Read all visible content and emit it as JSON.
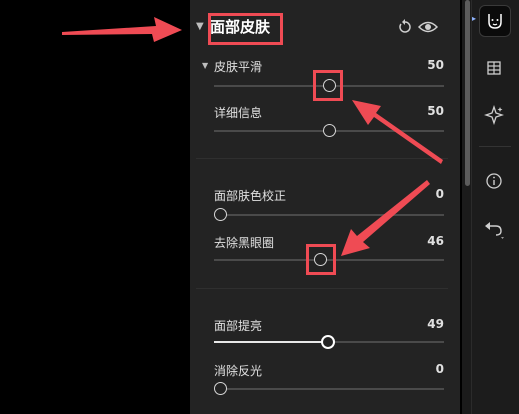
{
  "section": {
    "title": "面部皮肤",
    "caret": "▼",
    "reset_icon": "reset-icon",
    "visibility_icon": "eye-icon"
  },
  "sliders": [
    {
      "label": "皮肤平滑",
      "value": "50",
      "position": 0.5,
      "expanded_caret": "▼"
    },
    {
      "label": "详细信息",
      "value": "50",
      "position": 0.5
    },
    {
      "label": "面部肤色校正",
      "value": "0",
      "position": 0.0
    },
    {
      "label": "去除黑眼圈",
      "value": "46",
      "position": 0.46
    },
    {
      "label": "面部提亮",
      "value": "49",
      "position": 0.49,
      "active": true
    },
    {
      "label": "消除反光",
      "value": "0",
      "position": 0.0
    }
  ],
  "toolbar": {
    "items": [
      "face-retouch-icon",
      "crop-grid-icon",
      "sparkle-icon",
      "info-icon",
      "undo-icon"
    ]
  },
  "colors": {
    "panel_bg": "#232323",
    "highlight": "#ef4b54"
  }
}
